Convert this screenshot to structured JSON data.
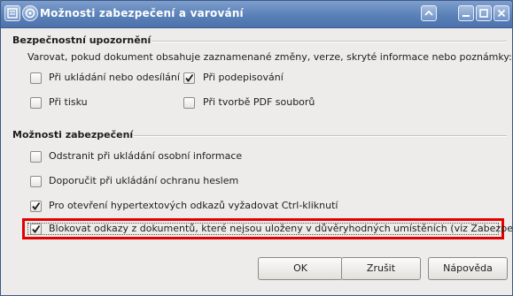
{
  "window": {
    "title": "Možnosti zabezpečení a varování"
  },
  "warnings_section": {
    "title": "Bezpečnostní upozornění",
    "description": "Varovat, pokud dokument obsahuje zaznamenané změny, verze, skryté informace nebo poznámky:",
    "options": {
      "saving": {
        "label": "Při ukládání nebo odesílání",
        "checked": false
      },
      "signing": {
        "label": "Při podepisování",
        "checked": true
      },
      "printing": {
        "label": "Při tisku",
        "checked": false
      },
      "pdf": {
        "label": "Při tvorbě PDF souborů",
        "checked": false
      }
    }
  },
  "security_section": {
    "title": "Možnosti zabezpečení",
    "options": {
      "remove_personal": {
        "label": "Odstranit při ukládání osobní informace",
        "checked": false
      },
      "recommend_password": {
        "label": "Doporučit při ukládání ochranu heslem",
        "checked": false
      },
      "ctrl_click": {
        "label": "Pro otevření hypertextových odkazů vyžadovat Ctrl-kliknutí",
        "checked": true
      },
      "block_links": {
        "label": "Blokovat odkazy z dokumentů, které nejsou uloženy v důvěryhodných umístěních (viz Zabezpečení maker)",
        "checked": true
      }
    }
  },
  "buttons": {
    "ok": "OK",
    "cancel": "Zrušit",
    "help": "Nápověda"
  },
  "colors": {
    "highlight_border": "#e30000",
    "titlebar": "#5a80b8"
  }
}
